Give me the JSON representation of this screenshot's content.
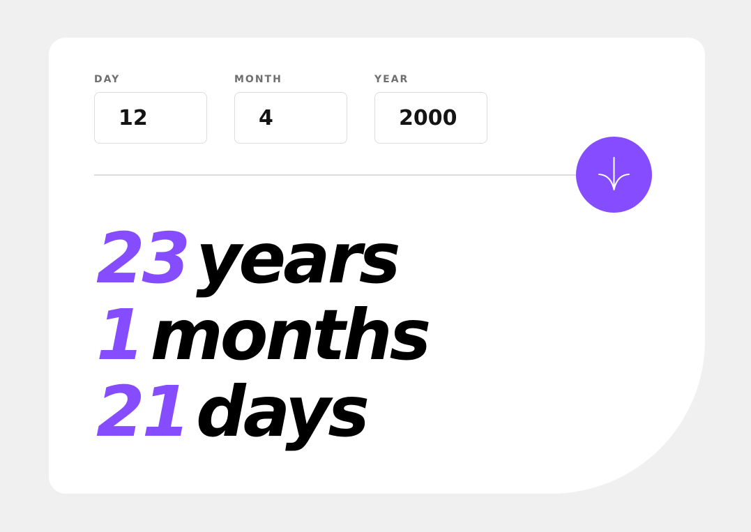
{
  "colors": {
    "accent": "#854dff",
    "background": "#f0f0f0",
    "card": "#ffffff",
    "label": "#6f6f6f",
    "text": "#000000",
    "border": "#dcdcdc"
  },
  "form": {
    "day": {
      "label": "DAY",
      "value": "12"
    },
    "month": {
      "label": "MONTH",
      "value": "4"
    },
    "year": {
      "label": "YEAR",
      "value": "2000"
    },
    "submit_icon": "arrow-down-icon"
  },
  "results": {
    "years": {
      "value": "23",
      "unit": "years"
    },
    "months": {
      "value": "1",
      "unit": "months"
    },
    "days": {
      "value": "21",
      "unit": "days"
    }
  }
}
